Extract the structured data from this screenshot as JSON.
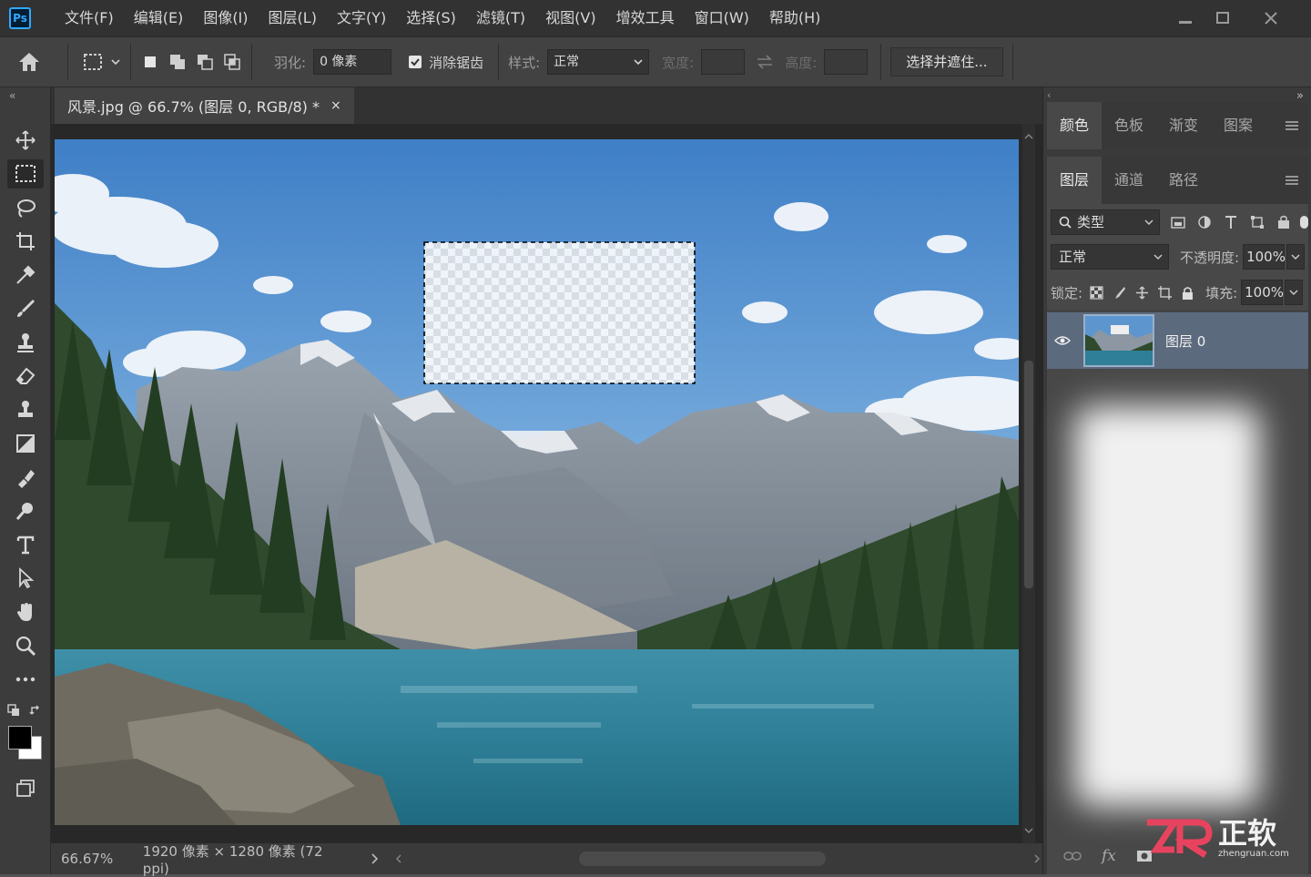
{
  "app": {
    "logo": "Ps"
  },
  "menu": [
    "文件(F)",
    "编辑(E)",
    "图像(I)",
    "图层(L)",
    "文字(Y)",
    "选择(S)",
    "滤镜(T)",
    "视图(V)",
    "增效工具",
    "窗口(W)",
    "帮助(H)"
  ],
  "options": {
    "feather_label": "羽化:",
    "feather_value": "0 像素",
    "antialias_label": "消除锯齿",
    "style_label": "样式:",
    "style_value": "正常",
    "width_label": "宽度:",
    "height_label": "高度:",
    "select_mask_button": "选择并遮住..."
  },
  "document": {
    "tab_title": "风景.jpg @ 66.7% (图层 0, RGB/8) *",
    "close": "×",
    "zoom": "66.67%",
    "info": "1920 像素 × 1280 像素 (72 ppi)"
  },
  "panels": {
    "top_tabs": [
      "颜色",
      "色板",
      "渐变",
      "图案"
    ],
    "layer_tabs": [
      "图层",
      "通道",
      "路径"
    ],
    "filter_label": "类型",
    "blend_mode": "正常",
    "opacity_label": "不透明度:",
    "opacity_value": "100%",
    "lock_label": "锁定:",
    "fill_label": "填充:",
    "fill_value": "100%",
    "layer_name": "图层 0"
  },
  "watermark": {
    "brand": "正软",
    "url": "zhengruan.com"
  },
  "colors": {
    "accent": "#31a8ff",
    "panel": "#3a3a3a",
    "canvas_bg": "#282828"
  },
  "icons": [
    "home-icon",
    "marquee-icon",
    "move-icon",
    "lasso-icon",
    "crop-icon",
    "eyedropper-icon",
    "brush-icon",
    "stamp-icon",
    "eraser-icon",
    "gradient-icon",
    "smudge-icon",
    "pen-icon",
    "type-icon",
    "path-select-icon",
    "hand-icon",
    "zoom-icon",
    "more-icon",
    "eye-icon",
    "link-icon",
    "fx-icon",
    "mask-icon"
  ]
}
